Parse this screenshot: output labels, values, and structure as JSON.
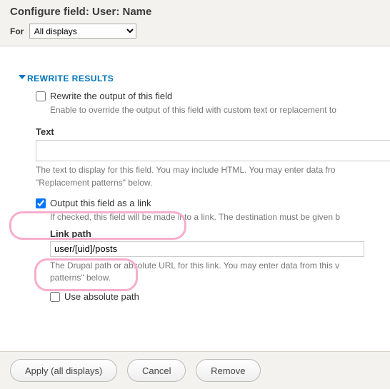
{
  "header": {
    "title": "Configure field: User: Name",
    "for_label": "For",
    "displays_selected": "All displays"
  },
  "rewrite": {
    "legend": "REWRITE RESULTS",
    "rewrite_output": {
      "checked": false,
      "label": "Rewrite the output of this field",
      "desc": "Enable to override the output of this field with custom text or replacement to"
    },
    "text": {
      "label": "Text",
      "value": "",
      "desc": "The text to display for this field. You may include HTML. You may enter data fro \"Replacement patterns\" below."
    },
    "output_as_link": {
      "checked": true,
      "label": "Output this field as a link",
      "desc": "If checked, this field will be made into a link. The destination must be given b"
    },
    "link_path": {
      "label": "Link path",
      "value": "user/[uid]/posts",
      "desc": "The Drupal path or absolute URL for this link. You may enter data from this v patterns\" below."
    },
    "use_absolute": {
      "checked": false,
      "label": "Use absolute path"
    }
  },
  "footer": {
    "apply": "Apply (all displays)",
    "cancel": "Cancel",
    "remove": "Remove"
  }
}
